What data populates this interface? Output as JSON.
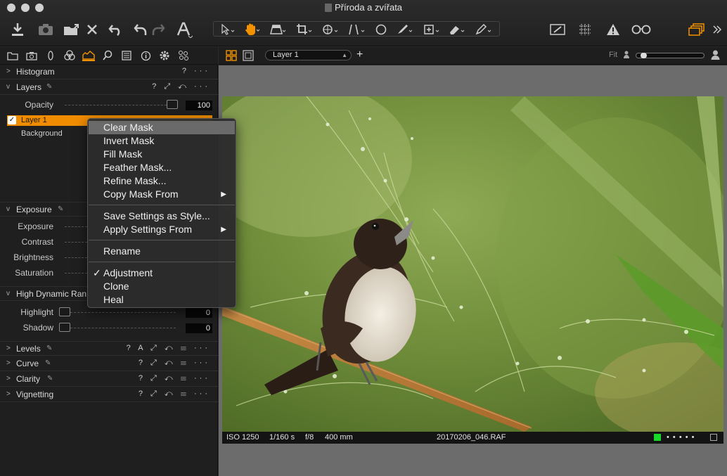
{
  "window": {
    "title": "Příroda a zvířata"
  },
  "viewer_toolbar": {
    "layer_select": "Layer 1",
    "add_layer_symbol": "+",
    "zoom_label": "Fit"
  },
  "panels": {
    "histogram": {
      "title": "Histogram",
      "icons": "? ···"
    },
    "layers": {
      "title": "Layers",
      "icons": "? ⤢ ↶ ···",
      "opacity_label": "Opacity",
      "opacity_value": "100",
      "items": [
        {
          "label": "Layer 1",
          "checked": true,
          "selected": true
        },
        {
          "label": "Background",
          "checked": false,
          "selected": false
        }
      ]
    },
    "exposure": {
      "title": "Exposure",
      "rows": [
        {
          "label": "Exposure"
        },
        {
          "label": "Contrast"
        },
        {
          "label": "Brightness"
        },
        {
          "label": "Saturation"
        }
      ]
    },
    "hdr": {
      "title": "High Dynamic Ran",
      "rows": [
        {
          "label": "Highlight",
          "value": "0"
        },
        {
          "label": "Shadow",
          "value": "0"
        }
      ]
    },
    "levels": {
      "title": "Levels",
      "icons": "? A ⤢ ↶ ☰ ···"
    },
    "curve": {
      "title": "Curve",
      "icons": "? ⤢ ↶ ☰ ···"
    },
    "clarity": {
      "title": "Clarity",
      "icons": "? ⤢ ↶ ☰ ···"
    },
    "vignetting": {
      "title": "Vignetting",
      "icons": "? ⤢ ↶ ☰ ···"
    }
  },
  "context_menu": {
    "items": [
      {
        "label": "Clear Mask"
      },
      {
        "label": "Invert Mask"
      },
      {
        "label": "Fill Mask"
      },
      {
        "label": "Feather Mask..."
      },
      {
        "label": "Refine Mask..."
      },
      {
        "label": "Copy Mask From",
        "submenu": "▶"
      },
      {
        "label": "Save Settings as Style..."
      },
      {
        "label": "Apply Settings From",
        "submenu": "▶"
      },
      {
        "label": "Rename"
      },
      {
        "label": "Adjustment",
        "checkmark": "✓"
      },
      {
        "label": "Clone"
      },
      {
        "label": "Heal"
      }
    ]
  },
  "image_info": {
    "iso": "ISO 1250",
    "shutter": "1/160 s",
    "aperture": "f/8",
    "focal_length": "400 mm",
    "filename": "20170206_046.RAF",
    "rating_dots": "• • • • •"
  },
  "colors": {
    "accent": "#f29200",
    "selection": "#f08c00",
    "status_green": "#18d82a"
  },
  "icons": {
    "toolbar": [
      "import-icon",
      "camera-icon",
      "export-icon",
      "delete-icon",
      "undo-icon",
      "undo-arrow-icon",
      "redo-arrow-icon",
      "text-icon",
      "select-cursor-icon",
      "hand-pan-icon",
      "crop-icon",
      "rotate-icon",
      "keystone-icon",
      "circle-mask-icon",
      "brush-icon",
      "spot-icon",
      "eraser-icon",
      "picker-icon",
      "edit-mask-icon",
      "grid-icon",
      "warning-icon",
      "glasses-icon",
      "layers-stack-icon",
      "chevron-double-right-icon"
    ],
    "tool_tabs": [
      "folder-icon",
      "camera-icon",
      "lens-icon",
      "color-icon",
      "exposure-icon",
      "search-icon",
      "metadata-icon",
      "info-icon",
      "gear-icon",
      "adjustments-icon"
    ]
  }
}
